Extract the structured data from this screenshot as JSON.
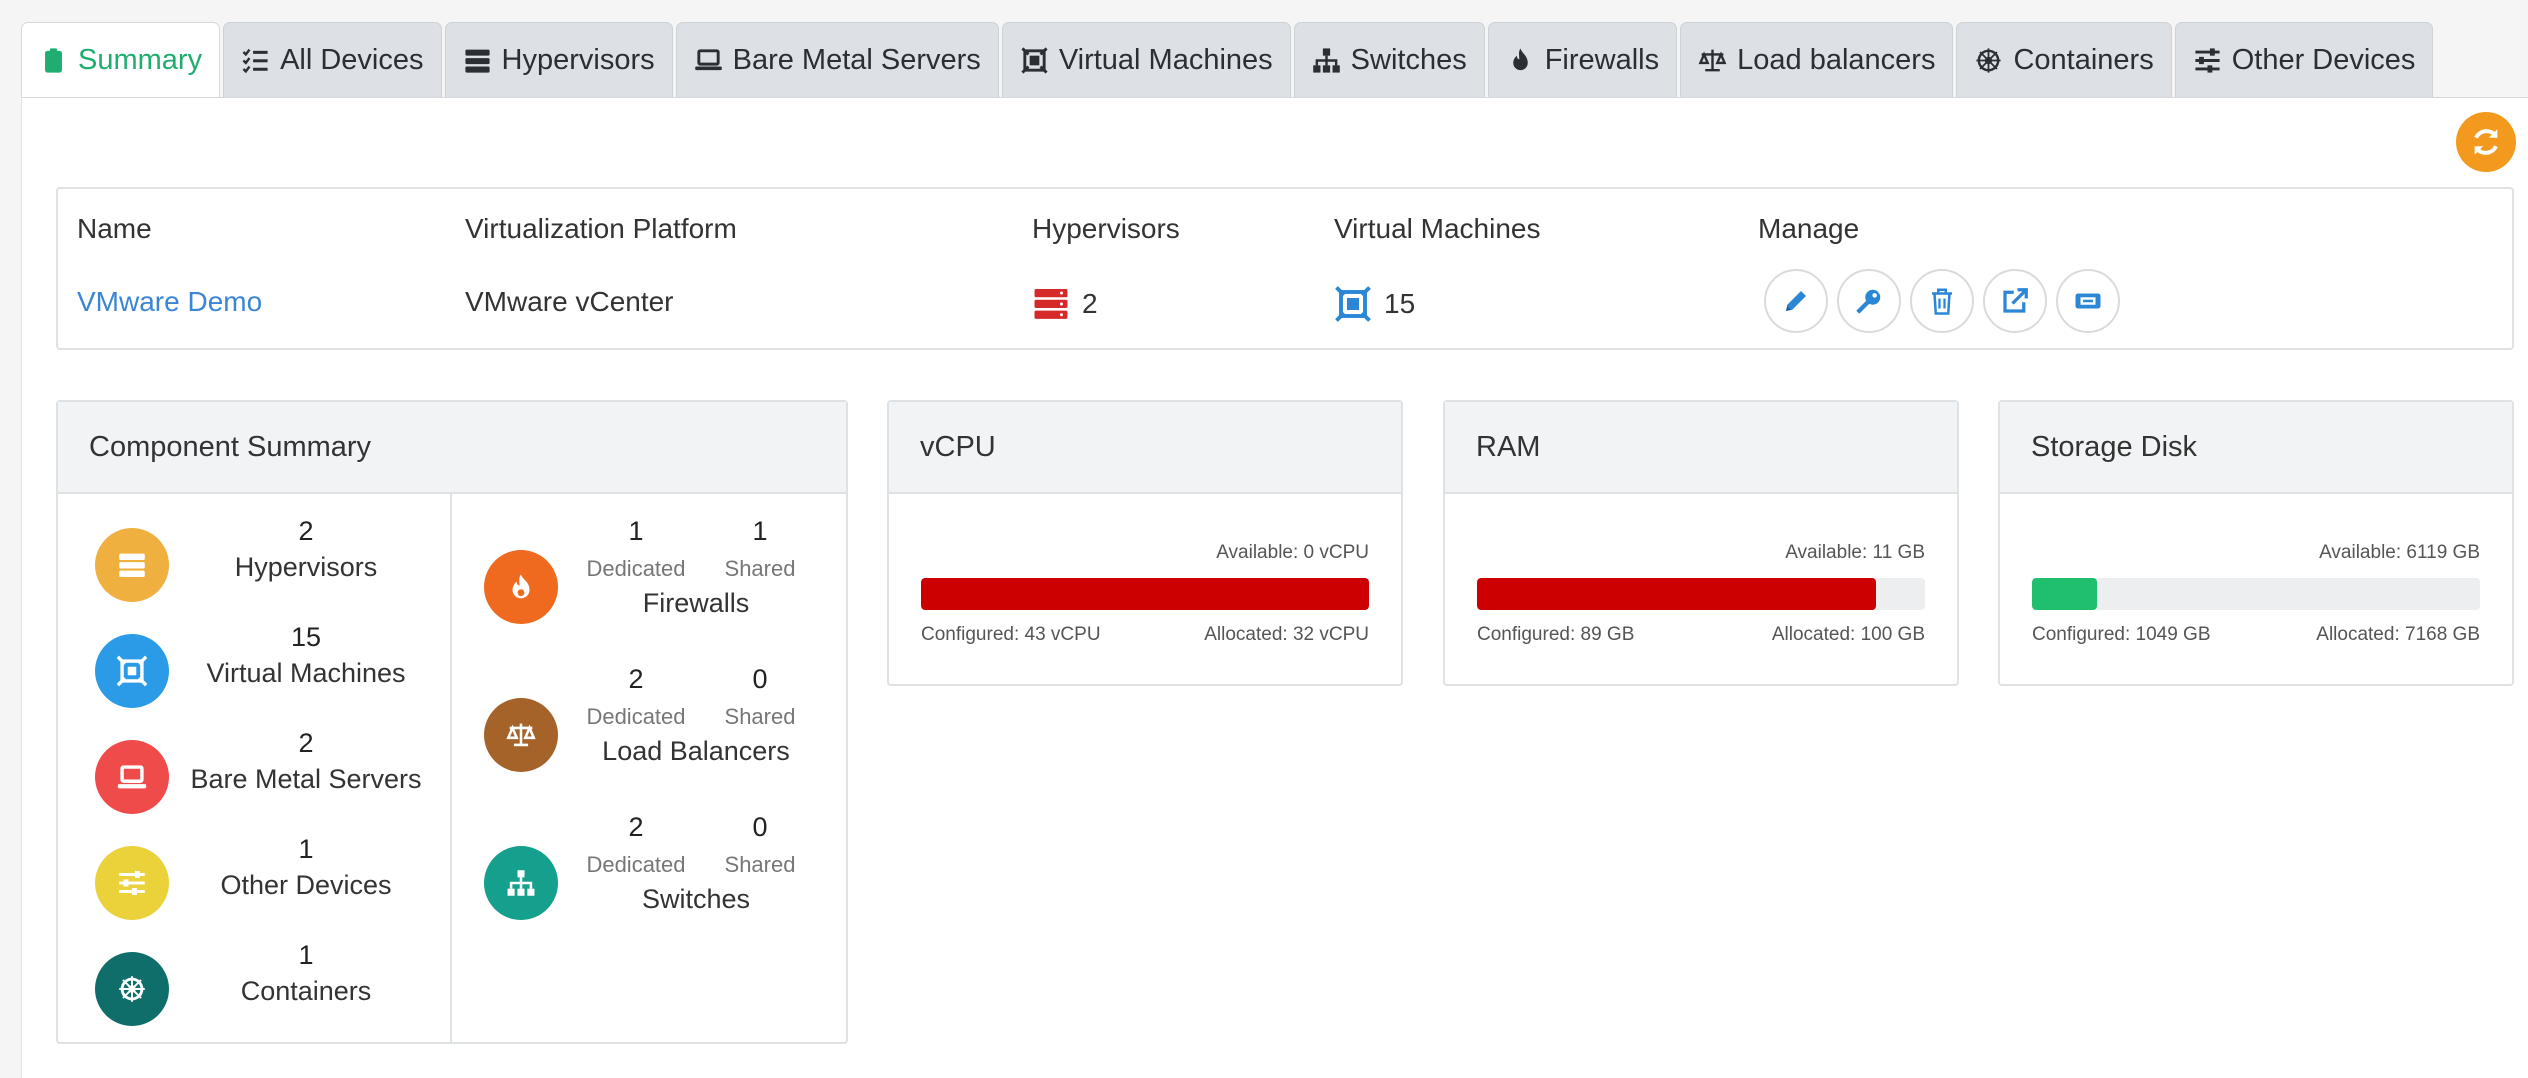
{
  "colors": {
    "accent_green": "#1fae6f",
    "link_blue": "#3b86d4",
    "refresh_orange": "#f39a1e",
    "bar_red": "#cc0000",
    "bar_green": "#1fbf6e"
  },
  "tabs": [
    {
      "label": "Summary",
      "icon": "clipboard-icon",
      "active": true
    },
    {
      "label": "All Devices",
      "icon": "checklist-icon"
    },
    {
      "label": "Hypervisors",
      "icon": "server-stack-icon"
    },
    {
      "label": "Bare Metal Servers",
      "icon": "laptop-icon"
    },
    {
      "label": "Virtual Machines",
      "icon": "vm-icon"
    },
    {
      "label": "Switches",
      "icon": "network-tree-icon"
    },
    {
      "label": "Firewalls",
      "icon": "flame-icon"
    },
    {
      "label": "Load balancers",
      "icon": "balance-scale-icon"
    },
    {
      "label": "Containers",
      "icon": "helm-icon"
    },
    {
      "label": "Other Devices",
      "icon": "sliders-icon"
    }
  ],
  "platform": {
    "headers": {
      "name": "Name",
      "platform": "Virtualization Platform",
      "hypervisors": "Hypervisors",
      "vms": "Virtual Machines",
      "manage": "Manage"
    },
    "row": {
      "name": "VMware Demo",
      "platform": "VMware vCenter",
      "hypervisors": "2",
      "vms": "15"
    },
    "manage_icons": [
      "pencil-icon",
      "key-icon",
      "trash-icon",
      "external-link-icon",
      "console-icon"
    ]
  },
  "component_summary": {
    "title": "Component Summary",
    "left": [
      {
        "count": "2",
        "label": "Hypervisors",
        "icon": "server-stack-icon",
        "color": "#f0b03f"
      },
      {
        "count": "15",
        "label": "Virtual Machines",
        "icon": "vm-icon",
        "color": "#2b9be8"
      },
      {
        "count": "2",
        "label": "Bare Metal Servers",
        "icon": "laptop-icon",
        "color": "#f04b4b"
      },
      {
        "count": "1",
        "label": "Other Devices",
        "icon": "sliders-icon",
        "color": "#ebd13a"
      },
      {
        "count": "1",
        "label": "Containers",
        "icon": "helm-icon",
        "color": "#0f6e6a"
      }
    ],
    "right": [
      {
        "dedicated": "1",
        "shared": "1",
        "label": "Firewalls",
        "icon": "flame-icon",
        "color": "#ef6a1e"
      },
      {
        "dedicated": "2",
        "shared": "0",
        "label": "Load Balancers",
        "icon": "balance-scale-icon",
        "color": "#a5632a"
      },
      {
        "dedicated": "2",
        "shared": "0",
        "label": "Switches",
        "icon": "network-tree-icon",
        "color": "#14a08c"
      }
    ],
    "dedicated_label": "Dedicated",
    "shared_label": "Shared"
  },
  "resources": [
    {
      "title": "vCPU",
      "available": "Available: 0 vCPU",
      "configured": "Configured: 43 vCPU",
      "allocated": "Allocated: 32 vCPU",
      "fill_fraction": 1.0,
      "color": "#cc0000"
    },
    {
      "title": "RAM",
      "available": "Available: 11 GB",
      "configured": "Configured: 89 GB",
      "allocated": "Allocated: 100 GB",
      "fill_fraction": 0.89,
      "color": "#cc0000"
    },
    {
      "title": "Storage Disk",
      "available": "Available: 6119 GB",
      "configured": "Configured: 1049 GB",
      "allocated": "Allocated: 7168 GB",
      "fill_fraction": 0.146,
      "color": "#1fbf6e"
    }
  ]
}
